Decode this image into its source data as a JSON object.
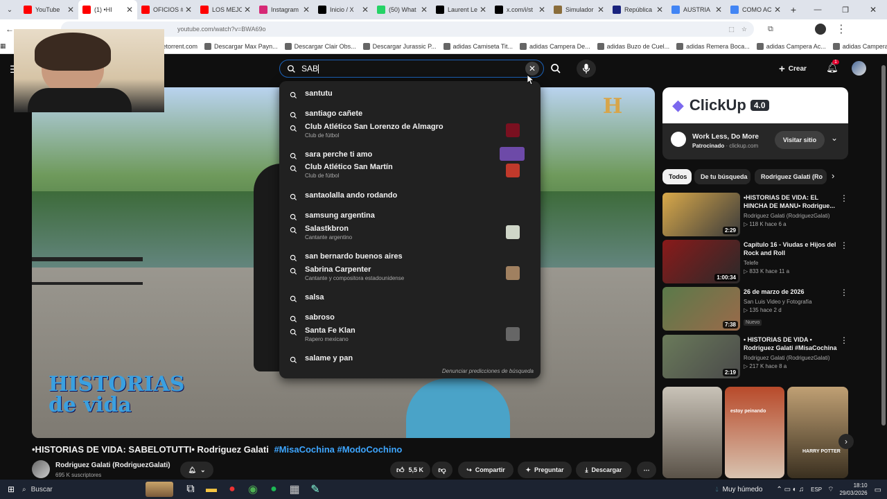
{
  "browser": {
    "tabs": [
      {
        "label": "YouTube",
        "color": "#ff0000"
      },
      {
        "label": "(1) •HI",
        "color": "#ff0000",
        "active": true
      },
      {
        "label": "OFICIOS #",
        "color": "#ff0000"
      },
      {
        "label": "LOS MEJO",
        "color": "#ff0000"
      },
      {
        "label": "Instagram",
        "color": "#d62976"
      },
      {
        "label": "Inicio / X",
        "color": "#000000"
      },
      {
        "label": "(50) What",
        "color": "#25d366"
      },
      {
        "label": "Laurent Le",
        "color": "#000000"
      },
      {
        "label": "x.com/i/st",
        "color": "#000000"
      },
      {
        "label": "Simulador",
        "color": "#8a6d3b"
      },
      {
        "label": "República",
        "color": "#1a237e"
      },
      {
        "label": "AUSTRIA",
        "color": "#4285f4"
      },
      {
        "label": "COMO AC",
        "color": "#4285f4"
      }
    ],
    "url": "youtube.com/watch?v=BWA69o",
    "bookmarks": [
      "etorrent.com",
      "Descargar Max Payn...",
      "Descargar Clair Obs...",
      "Descargar Jurassic P...",
      "adidas Camiseta Tit...",
      "adidas Campera De...",
      "adidas Buzo de Cuel...",
      "adidas Remera Boca...",
      "adidas Campera Ac...",
      "adidas Campera De..."
    ]
  },
  "header": {
    "search_value": "SAB",
    "create_label": "Crear",
    "notif_count": "1"
  },
  "suggestions": [
    {
      "text": "santutu"
    },
    {
      "text": "santiago cañete"
    },
    {
      "text": "Club Atlético San Lorenzo de Almagro",
      "sub": "Club de fútbol",
      "thumb": "#7a1020"
    },
    {
      "text": "sara perche ti amo",
      "thumb": "#6d4aa8",
      "wide": true
    },
    {
      "text": "Club Atlético San Martín",
      "sub": "Club de fútbol",
      "thumb": "#c0392b"
    },
    {
      "text": "santaolalla ando rodando"
    },
    {
      "text": "samsung argentina"
    },
    {
      "text": "Salastkbron",
      "sub": "Cantante argentino",
      "thumb": "#cfd6c8"
    },
    {
      "text": "san bernardo buenos aires"
    },
    {
      "text": "Sabrina Carpenter",
      "sub": "Cantante y compositora estadounidense",
      "thumb": "#a08060"
    },
    {
      "text": "salsa"
    },
    {
      "text": "sabroso"
    },
    {
      "text": "Santa Fe Klan",
      "sub": "Rapero mexicano",
      "thumb": "#666666"
    },
    {
      "text": "salame y pan"
    }
  ],
  "report_label": "Denunciar predicciones de búsqueda",
  "video": {
    "title_main": "•HISTORIAS DE VIDA: SABELOTUTTI• Rodriguez Galati",
    "hashtags": "#MisaCochina #ModoCochino",
    "overlay_logo": "HISTORIAS de vida",
    "history_logo": "H"
  },
  "channel": {
    "name": "Rodriguez Galati (RodriguezGalati)",
    "subs": "695 K suscriptores"
  },
  "actions": {
    "likes": "5,5 K",
    "share": "Compartir",
    "ask": "Preguntar",
    "download": "Descargar"
  },
  "ad": {
    "brand": "ClickUp",
    "version": "4.0",
    "title": "Work Less, Do More",
    "sponsored": "Patrocinado",
    "domain": "clickup.com",
    "cta": "Visitar sitio"
  },
  "chips": [
    "Todos",
    "De tu búsqueda",
    "Rodriguez Galati (Ro"
  ],
  "related": [
    {
      "title1": "•HISTORIAS DE VIDA: EL",
      "title2": "HINCHA DE MANU• Rodrigue...",
      "channel": "Rodriguez Galati (RodriguezGalati)",
      "stats": "118 K  hace 6 a",
      "duration": "2:29",
      "c1": "#d9a94a",
      "c2": "#3b3b3b"
    },
    {
      "title1": "Capítulo 16 - Viudas e Hijos del",
      "title2": "Rock and Roll",
      "channel": "Telefe",
      "stats": "833 K  hace 11 a",
      "duration": "1:00:34",
      "c1": "#8a1a1a",
      "c2": "#2a2a2a"
    },
    {
      "title1": "26 de marzo de 2026",
      "title2": "",
      "channel": "San Luis Video y Fotografía",
      "stats": "135  hace 2 d",
      "duration": "7:38",
      "badge": "Nuevo",
      "c1": "#5a7a4a",
      "c2": "#9a6a4a"
    },
    {
      "title1": "• HISTORIAS DE VIDA •",
      "title2": "Rodriguez Galati #MisaCochina",
      "channel": "Rodriguez Galati (RodriguezGalati)",
      "stats": "217 K  hace 8 a",
      "duration": "2:19",
      "c1": "#6a7a5a",
      "c2": "#4a4a4a"
    }
  ],
  "shorts_text": [
    "estoy peinando",
    "HARRY POTTER"
  ],
  "taskbar": {
    "search": "Buscar",
    "weather": "Muy húmedo",
    "lang": "ESP",
    "time": "18:10",
    "date": "29/03/2026"
  }
}
